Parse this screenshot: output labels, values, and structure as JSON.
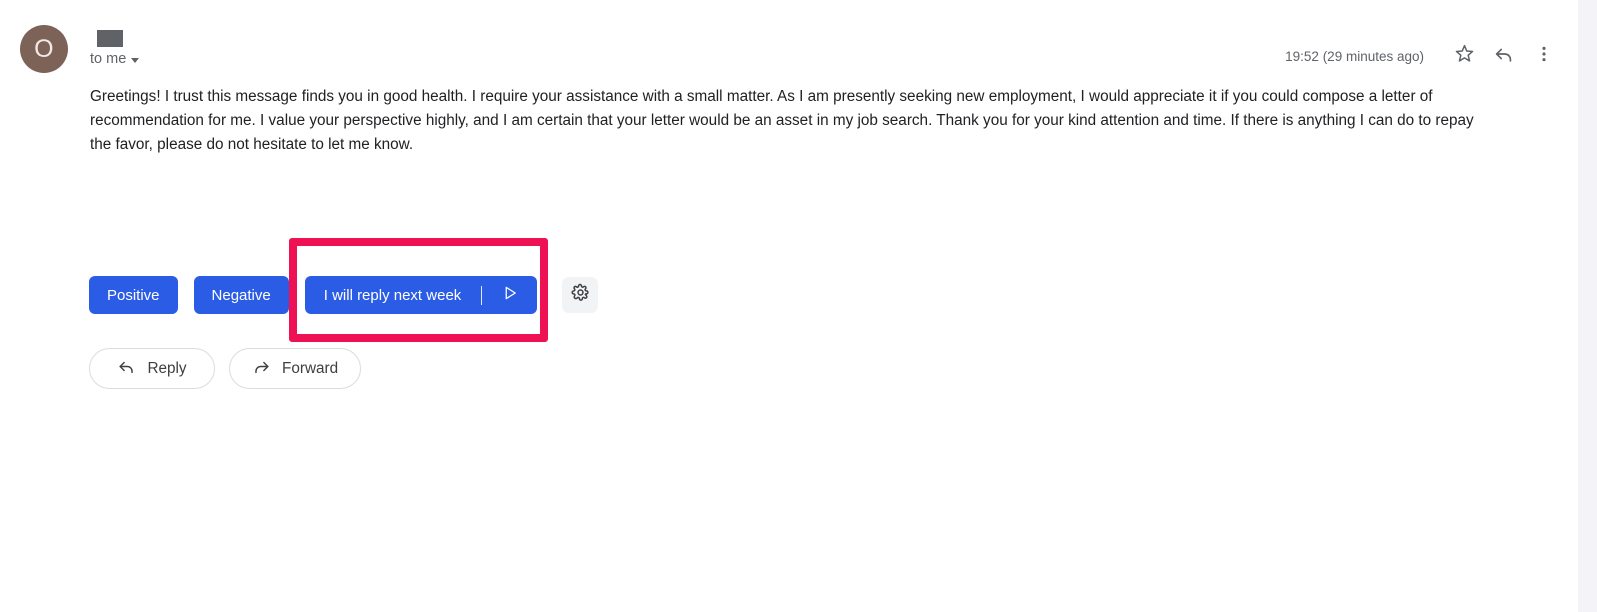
{
  "message": {
    "avatar": {
      "initial": "O",
      "background_color": "#7d6258",
      "text_color": "#f2e9e4"
    },
    "sender_name_redacted": true,
    "recipient_label": "to me",
    "recipient_caret_icon": "chevron-down-icon",
    "timestamp": "19:52 (29 minutes ago)",
    "body": "Greetings! I trust this message finds you in good health. I require your assistance with a small matter. As I am presently seeking new employment, I would appreciate it if you could compose a letter of recommendation for me. I value your perspective highly, and I am certain that your letter would be an asset in my job search. Thank you for your kind attention and time. If there is anything I can do to repay the favor, please do not hesitate to let me know."
  },
  "header_actions": [
    {
      "name": "star-icon",
      "label": "Star"
    },
    {
      "name": "reply-icon",
      "label": "Reply"
    },
    {
      "name": "more-vert-icon",
      "label": "More"
    }
  ],
  "smart_reply": {
    "chips": [
      {
        "label": "Positive",
        "name": "smart-reply-positive"
      },
      {
        "label": "Negative",
        "name": "smart-reply-negative"
      },
      {
        "label": "I will reply next week",
        "name": "smart-reply-next-week",
        "has_send": true
      }
    ],
    "send_icon": "send-triangle-icon",
    "settings_icon": "gear-icon"
  },
  "actions": {
    "reply_label": "Reply",
    "forward_label": "Forward",
    "reply_icon": "reply-arrow-icon",
    "forward_icon": "forward-arrow-icon"
  },
  "highlight": {
    "color": "#ee1255",
    "target": "smart-reply-next-week"
  },
  "colors": {
    "chip_blue": "#2b5ce6",
    "highlight_pink": "#ee1255",
    "text_primary": "#202124",
    "text_secondary": "#5f6368",
    "gutter": "#f4f4f8"
  }
}
